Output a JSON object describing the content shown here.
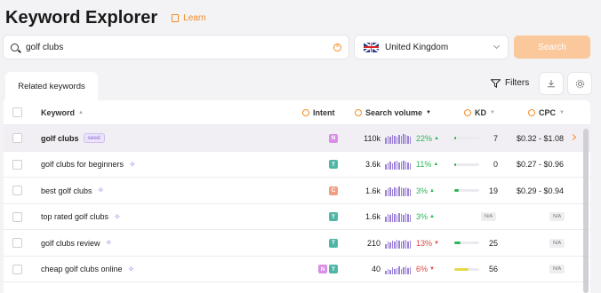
{
  "header": {
    "title": "Keyword Explorer",
    "learn_label": "Learn"
  },
  "search": {
    "value": "golf clubs",
    "button_label": "Search"
  },
  "country": {
    "name": "United Kingdom"
  },
  "tabs": [
    {
      "label": "Related keywords"
    }
  ],
  "toolbar": {
    "filters_label": "Filters"
  },
  "columns": {
    "keyword": "Keyword",
    "intent": "Intent",
    "volume": "Search volume",
    "kd": "KD",
    "cpc": "CPC"
  },
  "colors": {
    "accent": "#f28c28",
    "intent_N": "#d98fe6",
    "intent_T": "#4fb6a6",
    "intent_C": "#f0a080",
    "trend_up": "#2eb55a",
    "trend_down": "#e04444"
  },
  "rows": [
    {
      "keyword": "golf clubs",
      "seed": "seed",
      "intents": [
        "N"
      ],
      "volume": "110k",
      "trend": "22%",
      "trend_dir": "up",
      "kd": "7",
      "kd_level": 0.08,
      "kd_color": "#2eb55a",
      "cpc": "$0.32 - $1.08"
    },
    {
      "keyword": "golf clubs for beginners",
      "intents": [
        "T"
      ],
      "volume": "3.6k",
      "trend": "11%",
      "trend_dir": "up",
      "kd": "0",
      "kd_level": 0.0,
      "kd_color": "#2eb55a",
      "cpc": "$0.27 - $0.96"
    },
    {
      "keyword": "best golf clubs",
      "intents": [
        "C"
      ],
      "volume": "1.6k",
      "trend": "3%",
      "trend_dir": "up",
      "kd": "19",
      "kd_level": 0.19,
      "kd_color": "#2eb55a",
      "cpc": "$0.29 - $0.94"
    },
    {
      "keyword": "top rated golf clubs",
      "intents": [
        "T"
      ],
      "volume": "1.6k",
      "trend": "3%",
      "trend_dir": "up",
      "kd": "N/A",
      "kd_level": null,
      "kd_color": "",
      "cpc": "N/A"
    },
    {
      "keyword": "golf clubs review",
      "intents": [
        "T"
      ],
      "volume": "210",
      "trend": "13%",
      "trend_dir": "down",
      "kd": "25",
      "kd_level": 0.25,
      "kd_color": "#2eb55a",
      "cpc": "N/A"
    },
    {
      "keyword": "cheap golf clubs online",
      "intents": [
        "N",
        "T"
      ],
      "volume": "40",
      "trend": "6%",
      "trend_dir": "down",
      "kd": "56",
      "kd_level": 0.56,
      "kd_color": "#e3d94a",
      "cpc": "N/A"
    }
  ],
  "trend_bars": [
    [
      7,
      9,
      8,
      10,
      9,
      8,
      10,
      9,
      11,
      10,
      9,
      8
    ],
    [
      6,
      8,
      9,
      7,
      9,
      10,
      8,
      9,
      10,
      9,
      8,
      7
    ],
    [
      7,
      9,
      10,
      8,
      10,
      9,
      11,
      10,
      9,
      10,
      9,
      8
    ],
    [
      6,
      9,
      8,
      10,
      9,
      8,
      10,
      9,
      8,
      10,
      9,
      8
    ],
    [
      5,
      8,
      7,
      9,
      8,
      10,
      9,
      8,
      9,
      10,
      8,
      9
    ],
    [
      4,
      6,
      5,
      8,
      6,
      7,
      9,
      6,
      8,
      9,
      7,
      8
    ]
  ]
}
